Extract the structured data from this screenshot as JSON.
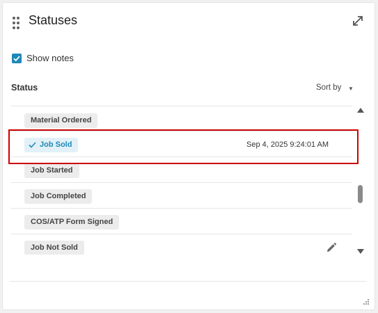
{
  "panel": {
    "title": "Statuses",
    "icons": {
      "drag": "drag-handle-icon",
      "expand": "expand-icon"
    }
  },
  "show_notes": {
    "label": "Show notes",
    "checked": true
  },
  "status_section": {
    "label": "Status",
    "sort_label": "Sort by",
    "items": [
      {
        "label": "Material Ordered",
        "date": "",
        "selected": false
      },
      {
        "label": "Job Sold",
        "date": "Sep 4, 2025 9:24:01 AM",
        "selected": true
      },
      {
        "label": "Job Started",
        "date": "",
        "selected": false
      },
      {
        "label": "Job Completed",
        "date": "",
        "selected": false
      },
      {
        "label": "COS/ATP Form Signed",
        "date": "",
        "selected": false
      },
      {
        "label": "Job Not Sold",
        "date": "",
        "selected": false
      }
    ]
  },
  "colors": {
    "accent": "#1e88b8",
    "highlight": "#cc0000",
    "chip_bg": "#ececec"
  }
}
